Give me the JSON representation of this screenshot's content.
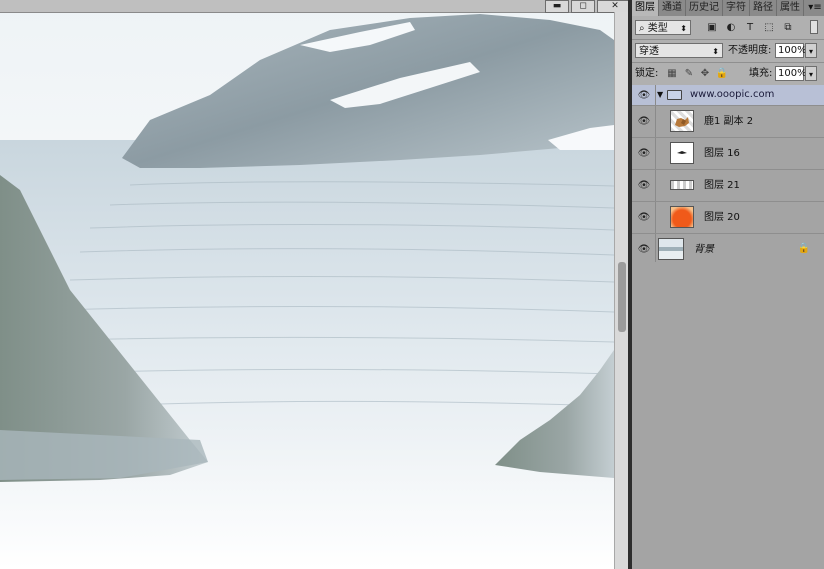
{
  "window": {
    "minimize_glyph": "▬",
    "restore_glyph": "◻",
    "close_glyph": "✕"
  },
  "panel": {
    "tabs": [
      {
        "label": "图层",
        "active": true
      },
      {
        "label": "通道",
        "active": false
      },
      {
        "label": "历史记",
        "active": false
      },
      {
        "label": "字符",
        "active": false
      },
      {
        "label": "路径",
        "active": false
      },
      {
        "label": "属性",
        "active": false
      }
    ],
    "menu_glyph": "▾≡",
    "filter": {
      "search_glyph": "⌕",
      "value": "类型",
      "icons": [
        "image-filter-icon",
        "adjustment-filter-icon",
        "type-filter-icon",
        "shape-filter-icon",
        "smart-object-filter-icon"
      ],
      "icon_glyphs": [
        "▣",
        "◐",
        "T",
        "⬚",
        "⧉"
      ]
    },
    "blend_mode": "穿透",
    "opacity_label": "不透明度:",
    "opacity_value": "100%",
    "lock_label": "锁定:",
    "fill_label": "填充:",
    "fill_value": "100%",
    "layers": [
      {
        "name": "www.ooopic.com",
        "type": "group",
        "visible": true
      },
      {
        "name": "鹿1 副本 2",
        "type": "layer",
        "visible": true
      },
      {
        "name": "图层 16",
        "type": "layer",
        "visible": true
      },
      {
        "name": "图层 21",
        "type": "layer",
        "visible": true
      },
      {
        "name": "图层 20",
        "type": "layer",
        "visible": true
      },
      {
        "name": "背景",
        "type": "background",
        "visible": true,
        "locked": true
      }
    ]
  },
  "colors": {
    "panel_bg": "#a4a4a4",
    "selected_group": "#b8c0d6"
  }
}
